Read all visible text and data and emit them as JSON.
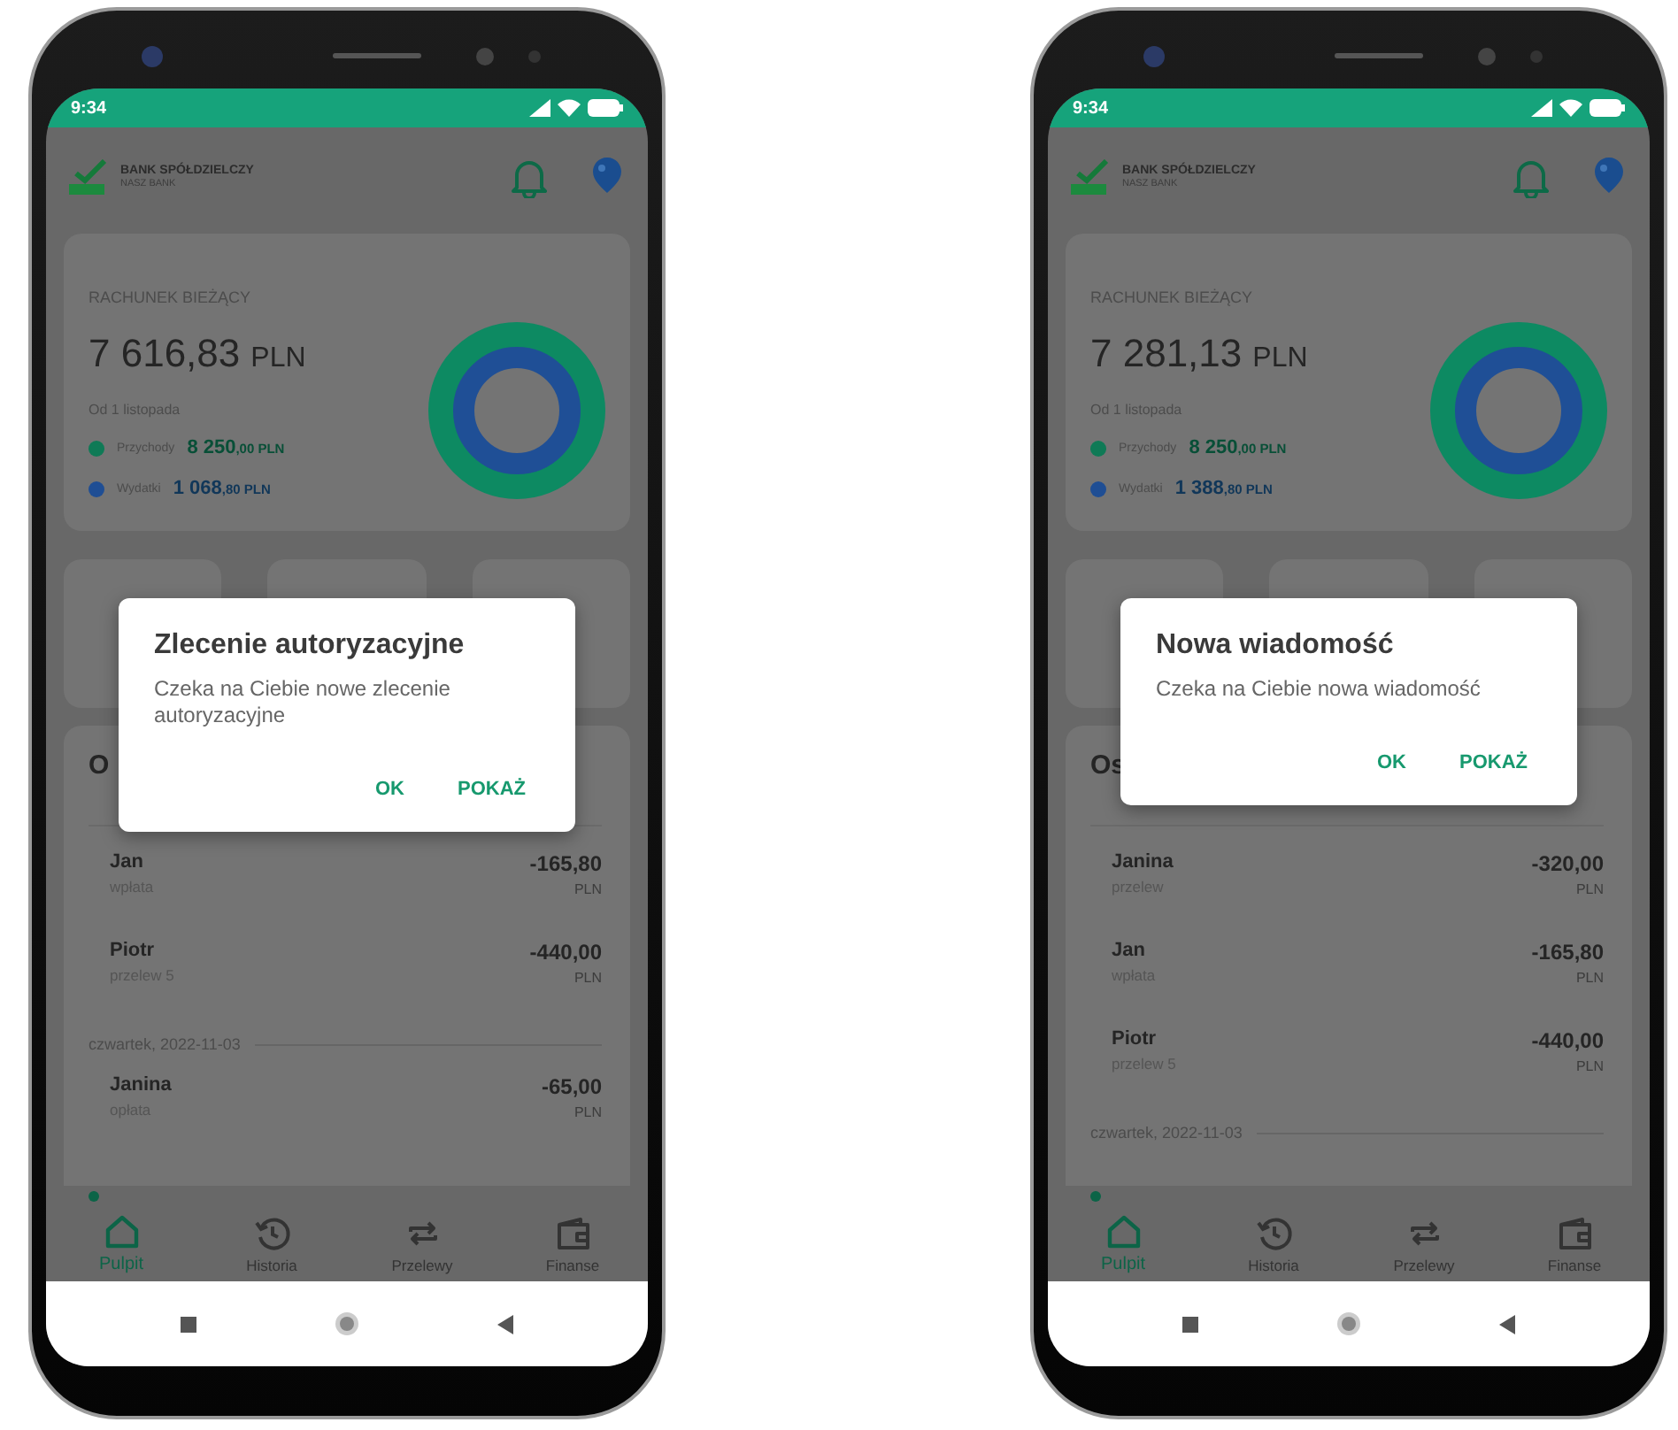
{
  "phones": [
    {
      "status_bar": {
        "time": "9:34"
      },
      "header": {
        "bank_name": "BANK SPÓŁDZIELCZY",
        "bank_subtitle": "NASZ BANK"
      },
      "account": {
        "label": "RACHUNEK BIEŻĄCY",
        "balance": "7 616,83",
        "currency": "PLN",
        "period": "Od 1 listopada",
        "legend": [
          {
            "label": "Przychody",
            "amount": "8 250",
            "amount_minor": ",00 PLN",
            "color": "#0f7a56"
          },
          {
            "label": "Wydatki",
            "amount": "1 068",
            "amount_minor": ",80 PLN",
            "color": "#1f4e94"
          }
        ]
      },
      "transactions": {
        "heading": "O",
        "items": [
          {
            "kind": "transaction",
            "name": "Jan",
            "type": "wpłata",
            "amount": "-165,80",
            "currency": "PLN"
          },
          {
            "kind": "transaction",
            "name": "Piotr",
            "type": "przelew 5",
            "amount": "-440,00",
            "currency": "PLN"
          },
          {
            "kind": "date",
            "label": "czwartek, 2022-11-03"
          },
          {
            "kind": "transaction",
            "name": "Janina",
            "type": "opłata",
            "amount": "-65,00",
            "currency": "PLN"
          }
        ]
      },
      "bottom_nav": [
        {
          "label": "Pulpit",
          "selected": true
        },
        {
          "label": "Historia",
          "selected": false
        },
        {
          "label": "Przelewy",
          "selected": false
        },
        {
          "label": "Finanse",
          "selected": false
        }
      ],
      "dialog": {
        "title": "Zlecenie autoryzacyjne",
        "message": "Czeka na Ciebie nowe zlecenie autoryzacyjne",
        "buttons": [
          "OK",
          "POKAŻ"
        ]
      }
    },
    {
      "status_bar": {
        "time": "9:34"
      },
      "header": {
        "bank_name": "BANK SPÓŁDZIELCZY",
        "bank_subtitle": "NASZ BANK"
      },
      "account": {
        "label": "RACHUNEK BIEŻĄCY",
        "balance": "7 281,13",
        "currency": "PLN",
        "period": "Od 1 listopada",
        "legend": [
          {
            "label": "Przychody",
            "amount": "8 250",
            "amount_minor": ",00 PLN",
            "color": "#0f7a56"
          },
          {
            "label": "Wydatki",
            "amount": "1 388",
            "amount_minor": ",80 PLN",
            "color": "#1f4e94"
          }
        ]
      },
      "transactions": {
        "heading": "Os",
        "items": [
          {
            "kind": "transaction",
            "name": "Janina",
            "type": "przelew",
            "amount": "-320,00",
            "currency": "PLN"
          },
          {
            "kind": "transaction",
            "name": "Jan",
            "type": "wpłata",
            "amount": "-165,80",
            "currency": "PLN"
          },
          {
            "kind": "transaction",
            "name": "Piotr",
            "type": "przelew 5",
            "amount": "-440,00",
            "currency": "PLN"
          },
          {
            "kind": "date",
            "label": "czwartek, 2022-11-03"
          }
        ]
      },
      "bottom_nav": [
        {
          "label": "Pulpit",
          "selected": true
        },
        {
          "label": "Historia",
          "selected": false
        },
        {
          "label": "Przelewy",
          "selected": false
        },
        {
          "label": "Finanse",
          "selected": false
        }
      ],
      "dialog": {
        "title": "Nowa wiadomość",
        "message": "Czeka na Ciebie nowa wiadomość",
        "buttons": [
          "OK",
          "POKAŻ"
        ]
      }
    }
  ]
}
